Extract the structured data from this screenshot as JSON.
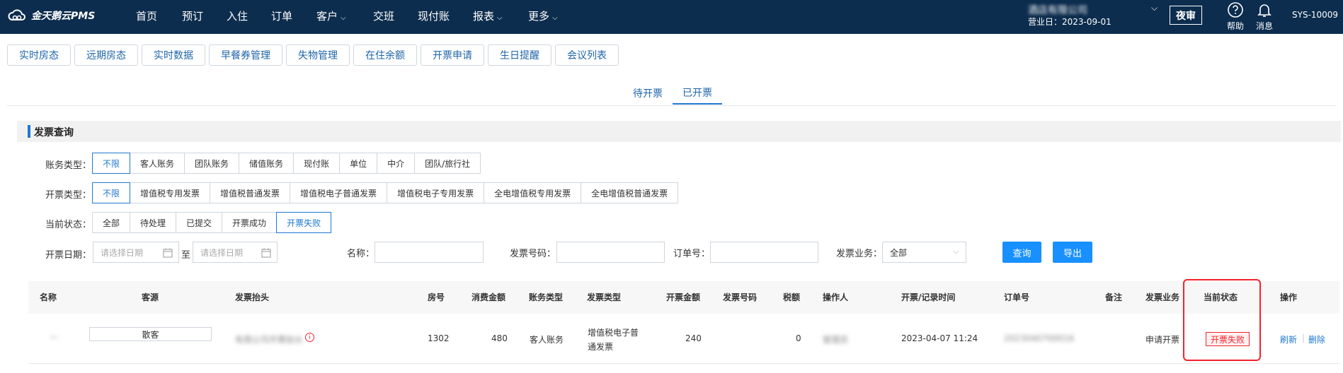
{
  "app": {
    "logo_text": "金天鹅云PMS"
  },
  "nav": {
    "items": [
      "首页",
      "预订",
      "入住",
      "订单",
      "客户",
      "交班",
      "现付账",
      "报表",
      "更多"
    ],
    "hotel_name": "酒店有限公司",
    "business_date": "营业日：2023-09-01",
    "night_audit": "夜审",
    "help": "帮助",
    "messages": "消息",
    "user": "SYS-10009"
  },
  "module_tabs": [
    "实时房态",
    "远期房态",
    "实时数据",
    "早餐券管理",
    "失物管理",
    "在住余额",
    "开票申请",
    "生日提醒",
    "会议列表"
  ],
  "sub_tabs": [
    "待开票",
    "已开票"
  ],
  "section_title": "发票查询",
  "filters": {
    "account_type": {
      "label": "账务类型：",
      "options": [
        "不限",
        "客人账务",
        "团队账务",
        "储值账务",
        "现付账",
        "单位",
        "中介",
        "团队/旅行社"
      ]
    },
    "invoice_type": {
      "label": "开票类型：",
      "options": [
        "不限",
        "增值税专用发票",
        "增值税普通发票",
        "增值税电子普通发票",
        "增值税电子专用发票",
        "全电增值税专用发票",
        "全电增值税普通发票"
      ]
    },
    "status": {
      "label": "当前状态：",
      "options": [
        "全部",
        "待处理",
        "已提交",
        "开票成功",
        "开票失败"
      ]
    },
    "date": {
      "label": "开票日期：",
      "start_placeholder": "请选择日期",
      "to": "至",
      "end_placeholder": "请选择日期"
    },
    "name_label": "名称：",
    "invoice_no_label": "发票号码：",
    "order_no_label": "订单号：",
    "business_label": "发票业务：",
    "business_value": "全部",
    "search_btn": "查询",
    "export_btn": "导出"
  },
  "table": {
    "headers": [
      "名称",
      "客源",
      "发票抬头",
      "房号",
      "消费金额",
      "账务类型",
      "发票类型",
      "开票金额",
      "发票号码",
      "税额",
      "操作人",
      "开票/记录时间",
      "订单号",
      "备注",
      "发票业务",
      "当前状态",
      "操作"
    ],
    "rows": [
      {
        "name": "—",
        "source": "散客",
        "title": "有限公司开票抬头",
        "room": "1302",
        "amount": "480",
        "account_type": "客人账务",
        "invoice_type_line1": "增值税电子普",
        "invoice_type_line2": "通发票",
        "invoice_amount": "240",
        "tax": "0",
        "operator": "管理员",
        "time": "2023-04-07 11:24",
        "order_no": "2023040700016",
        "business": "申请开票",
        "status": "开票失败",
        "action_refresh": "刷新",
        "action_delete": "删除"
      }
    ]
  }
}
